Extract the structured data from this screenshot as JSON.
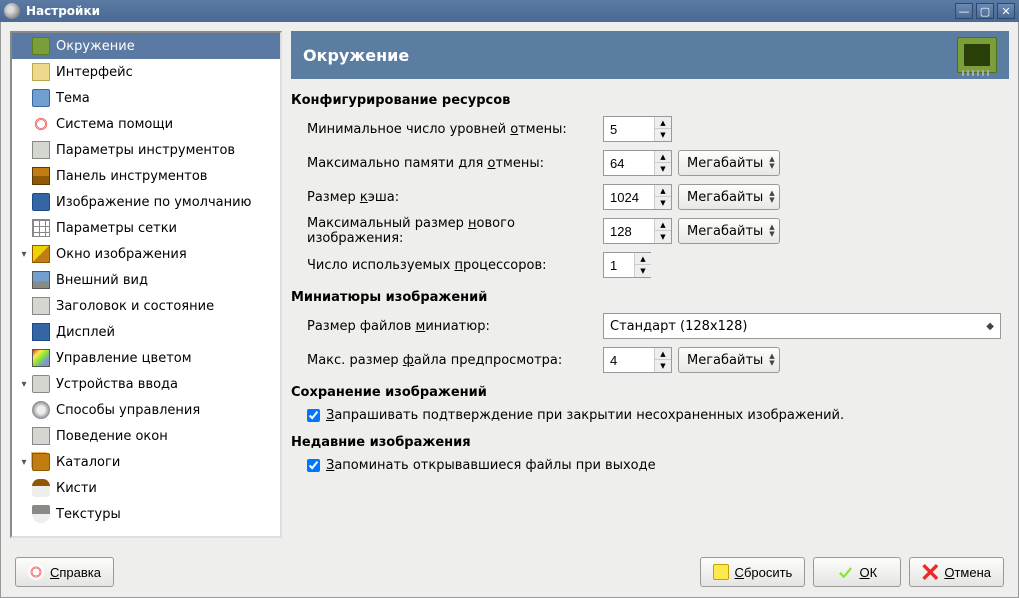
{
  "window": {
    "title": "Настройки"
  },
  "sidebar": {
    "items": [
      {
        "label": "Окружение",
        "icon": "ico-env",
        "selected": true,
        "depth": 0
      },
      {
        "label": "Интерфейс",
        "icon": "ico-interface",
        "depth": 0
      },
      {
        "label": "Тема",
        "icon": "ico-theme",
        "depth": 0
      },
      {
        "label": "Система помощи",
        "icon": "ico-help",
        "depth": 0
      },
      {
        "label": "Параметры инструментов",
        "icon": "ico-toolopt",
        "depth": 0
      },
      {
        "label": "Панель инструментов",
        "icon": "ico-toolbox",
        "depth": 0
      },
      {
        "label": "Изображение по умолчанию",
        "icon": "ico-defimg",
        "depth": 0
      },
      {
        "label": "Параметры сетки",
        "icon": "ico-grid",
        "depth": 0
      },
      {
        "label": "Окно изображения",
        "icon": "ico-imgwin",
        "depth": 0,
        "expander": "down"
      },
      {
        "label": "Внешний вид",
        "icon": "ico-appear",
        "depth": 1
      },
      {
        "label": "Заголовок и состояние",
        "icon": "ico-title",
        "depth": 1
      },
      {
        "label": "Дисплей",
        "icon": "ico-display",
        "depth": 0
      },
      {
        "label": "Управление цветом",
        "icon": "ico-color",
        "depth": 0
      },
      {
        "label": "Устройства ввода",
        "icon": "ico-input",
        "depth": 0,
        "expander": "down"
      },
      {
        "label": "Способы управления",
        "icon": "ico-ctrl",
        "depth": 1
      },
      {
        "label": "Поведение окон",
        "icon": "ico-wm",
        "depth": 0
      },
      {
        "label": "Каталоги",
        "icon": "ico-folders",
        "depth": 0,
        "expander": "down"
      },
      {
        "label": "Кисти",
        "icon": "ico-brush",
        "depth": 1
      },
      {
        "label": "Текстуры",
        "icon": "ico-texture",
        "depth": 1
      }
    ]
  },
  "panel": {
    "title": "Окружение",
    "sections": {
      "resources": {
        "title": "Конфигурирование ресурсов",
        "undo_levels": {
          "label_pre": "Минимальное число уровней ",
          "label_u": "о",
          "label_post": "тмены:",
          "value": "5"
        },
        "undo_memory": {
          "label_pre": "Максимально памяти для ",
          "label_u": "о",
          "label_post": "тмены:",
          "value": "64",
          "unit": "Мегабайты"
        },
        "cache_size": {
          "label_pre": "Размер ",
          "label_u": "к",
          "label_post": "эша:",
          "value": "1024",
          "unit": "Мегабайты"
        },
        "new_img_max": {
          "label_pre": "Максимальный размер ",
          "label_u": "н",
          "label_post": "ового изображения:",
          "value": "128",
          "unit": "Мегабайты"
        },
        "processors": {
          "label_pre": "Число используемых ",
          "label_u": "п",
          "label_post": "роцессоров:",
          "value": "1"
        }
      },
      "thumbnails": {
        "title": "Миниатюры изображений",
        "thumb_size": {
          "label_pre": "Размер файлов ",
          "label_u": "м",
          "label_post": "иниатюр:",
          "value": "Стандарт (128x128)"
        },
        "preview_max": {
          "label_pre": "Макс. размер ",
          "label_u": "ф",
          "label_post": "айла предпросмотра:",
          "value": "4",
          "unit": "Мегабайты"
        }
      },
      "saving": {
        "title": "Сохранение изображений",
        "confirm_close": {
          "label_pre": "",
          "label_u": "З",
          "label_post": "апрашивать подтверждение при закрытии несохраненных изображений.",
          "checked": true
        }
      },
      "recent": {
        "title": "Недавние изображения",
        "remember_open": {
          "label_pre": "",
          "label_u": "З",
          "label_post": "апоминать открывавшиеся файлы при выходе",
          "checked": true
        }
      }
    }
  },
  "buttons": {
    "help": {
      "u": "С",
      "rest": "правка"
    },
    "reset": {
      "u": "С",
      "rest": "бросить"
    },
    "ok": {
      "u": "О",
      "rest": "К"
    },
    "cancel": {
      "u": "О",
      "rest": "тмена"
    }
  }
}
